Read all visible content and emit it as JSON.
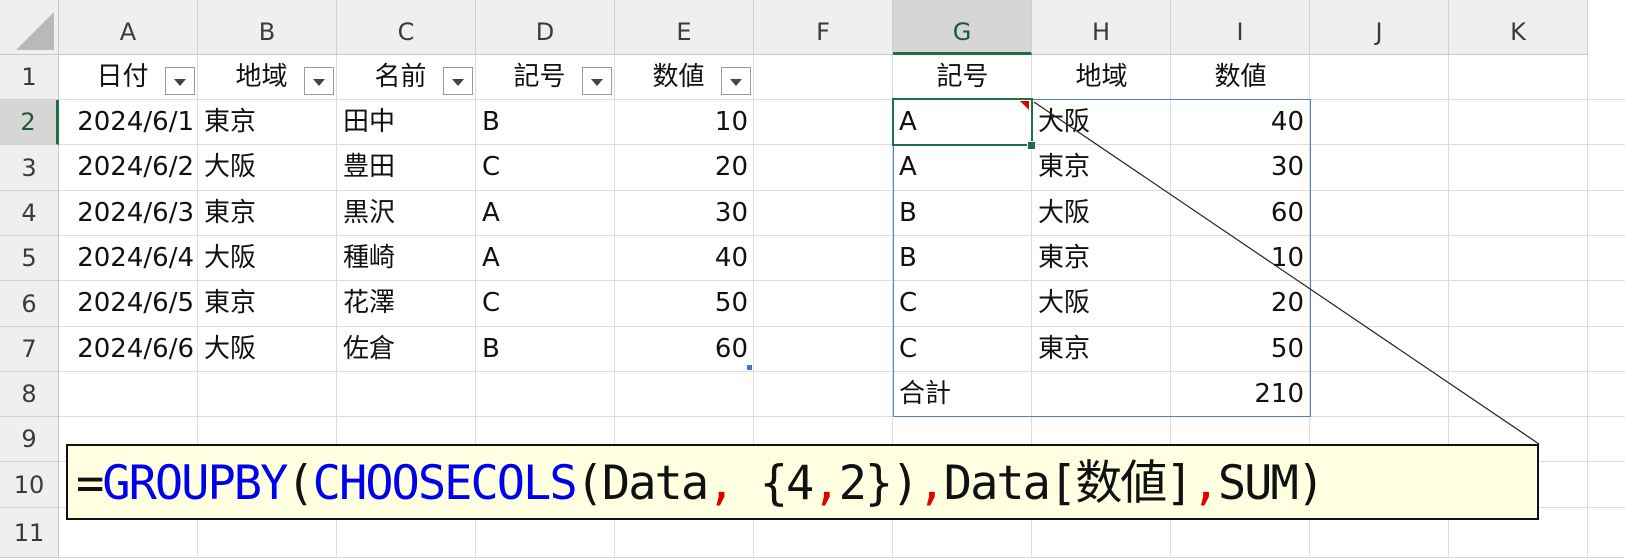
{
  "columns": [
    "A",
    "B",
    "C",
    "D",
    "E",
    "F",
    "G",
    "H",
    "I",
    "J",
    "K"
  ],
  "rows": [
    "1",
    "2",
    "3",
    "4",
    "5",
    "6",
    "7",
    "8",
    "9",
    "10",
    "11"
  ],
  "selected_column": "G",
  "selected_row": "2",
  "table": {
    "headers": [
      "日付",
      "地域",
      "名前",
      "記号",
      "数値"
    ],
    "rows": [
      [
        "2024/6/1",
        "東京",
        "田中",
        "B",
        "10"
      ],
      [
        "2024/6/2",
        "大阪",
        "豊田",
        "C",
        "20"
      ],
      [
        "2024/6/3",
        "東京",
        "黒沢",
        "A",
        "30"
      ],
      [
        "2024/6/4",
        "大阪",
        "種崎",
        "A",
        "40"
      ],
      [
        "2024/6/5",
        "東京",
        "花澤",
        "C",
        "50"
      ],
      [
        "2024/6/6",
        "大阪",
        "佐倉",
        "B",
        "60"
      ]
    ]
  },
  "result": {
    "headers": [
      "記号",
      "地域",
      "数値"
    ],
    "rows": [
      [
        "A",
        "大阪",
        "40"
      ],
      [
        "A",
        "東京",
        "30"
      ],
      [
        "B",
        "大阪",
        "60"
      ],
      [
        "B",
        "東京",
        "10"
      ],
      [
        "C",
        "大阪",
        "20"
      ],
      [
        "C",
        "東京",
        "50"
      ]
    ],
    "total_label": "合計",
    "total_value": "210"
  },
  "formula": {
    "parts": [
      {
        "text": "=",
        "style": "plain"
      },
      {
        "text": "GROUPBY",
        "style": "function"
      },
      {
        "text": "(",
        "style": "plain"
      },
      {
        "text": "CHOOSECOLS",
        "style": "function"
      },
      {
        "text": "(Data",
        "style": "plain"
      },
      {
        "text": ",",
        "style": "separator"
      },
      {
        "text": " {4",
        "style": "plain"
      },
      {
        "text": ",",
        "style": "separator"
      },
      {
        "text": "2})",
        "style": "plain"
      },
      {
        "text": ",",
        "style": "separator"
      },
      {
        "text": "Data[数値]",
        "style": "plain"
      },
      {
        "text": ",",
        "style": "separator"
      },
      {
        "text": "SUM)",
        "style": "plain"
      }
    ]
  },
  "colors": {
    "function": "#0000ee",
    "separator": "#e00000",
    "selection": "#1e7145",
    "spill_border": "#4f7fcf",
    "formula_background": "#ffffe1"
  }
}
